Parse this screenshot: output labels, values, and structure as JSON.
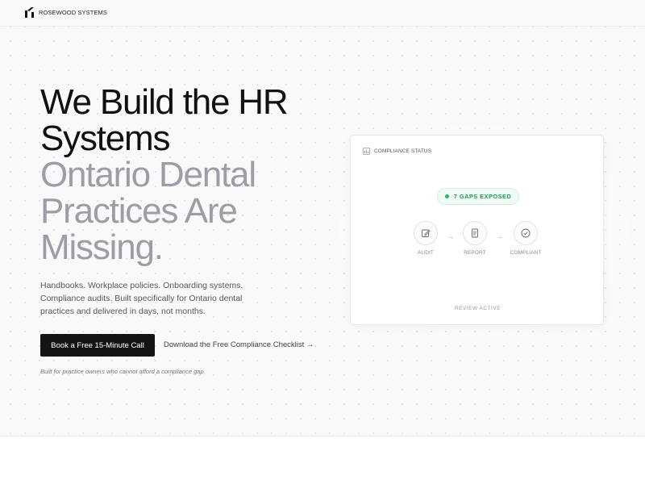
{
  "header": {
    "brand": "ROSEWOOD SYSTEMS"
  },
  "hero": {
    "headline_line1": "We Build the HR",
    "headline_line2": "Systems",
    "headline_line3": "Ontario Dental",
    "headline_line4": "Practices Are",
    "headline_line5": "Missing.",
    "description": "Handbooks. Workplace policies. Onboarding systems. Compliance audits. Built specifically for Ontario dental practices and delivered in days, not months.",
    "cta_label": "Book a Free 15-Minute Call",
    "secondary_link": "Download the Free Compliance Checklist →",
    "note": "Built for practice owners who cannot afford a compliance gap."
  },
  "card": {
    "title": "COMPLIANCE STATUS",
    "badge": "7 GAPS EXPOSED",
    "steps": [
      {
        "label": "AUDIT",
        "icon": "edit-icon"
      },
      {
        "label": "REPORT",
        "icon": "document-icon"
      },
      {
        "label": "COMPLIANT",
        "icon": "check-circle-icon"
      }
    ],
    "arrow": "→",
    "status": "REVIEW ACTIVE"
  },
  "colors": {
    "headline_dark": "#111111",
    "headline_muted": "#9d9da5",
    "cta_bg": "#141414",
    "badge_green": "#1f9a58",
    "badge_bg": "#effbf4"
  }
}
